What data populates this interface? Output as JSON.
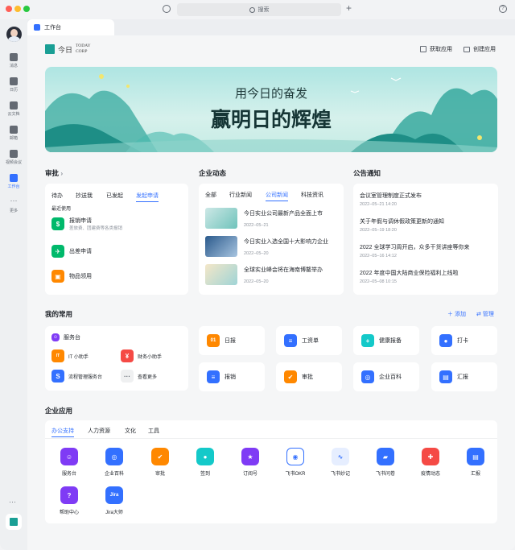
{
  "search": {
    "placeholder": "搜索"
  },
  "sidebar": {
    "items": [
      {
        "label": "消息",
        "icon": "chat-icon"
      },
      {
        "label": "日历",
        "icon": "calendar-icon"
      },
      {
        "label": "云文档",
        "icon": "docs-icon"
      },
      {
        "label": "邮箱",
        "icon": "mail-icon"
      },
      {
        "label": "视频会议",
        "icon": "video-icon"
      },
      {
        "label": "工作台",
        "icon": "workbench-icon",
        "active": true
      },
      {
        "label": "更多",
        "icon": "more-icon"
      }
    ]
  },
  "tab": {
    "label": "工作台"
  },
  "header": {
    "logo_line1": "TODAY",
    "logo_line2": "CORP",
    "logo_char": "今日",
    "get_apps": "获取应用",
    "create_app": "创建应用"
  },
  "banner": {
    "line1": "用今日的奋发",
    "line2": "赢明日的辉煌"
  },
  "approval": {
    "title": "审批",
    "tabs": [
      "待办",
      "抄送我",
      "已发起",
      "发起申请"
    ],
    "recent_label": "最近使用",
    "items": [
      {
        "name": "报销申请",
        "sub": "差旅费、团建费等各类报销",
        "color": "#00b96b"
      },
      {
        "name": "出差申请",
        "sub": "",
        "color": "#00b96b"
      },
      {
        "name": "物品领用",
        "sub": "",
        "color": "#ff8800"
      }
    ]
  },
  "news": {
    "title": "企业动态",
    "tabs": [
      "全部",
      "行业新闻",
      "公司新闻",
      "科技资讯"
    ],
    "items": [
      {
        "title": "今日实业公司最新产品全面上市",
        "date": "2022–05–21"
      },
      {
        "title": "今日实业入选全国十大影响力企业",
        "date": "2022–05–20"
      },
      {
        "title": "全球实业峰会将在海南博鳌举办",
        "date": "2022–05–20"
      }
    ]
  },
  "notice": {
    "title": "公告通知",
    "items": [
      {
        "title": "会议室管理制度正式发布",
        "date": "2022–05–21 14:20"
      },
      {
        "title": "关于年假与调休假政策更新的通知",
        "date": "2022–05–19 18:20"
      },
      {
        "title": "2022 全球学习周开启，众多干货讲座等你来",
        "date": "2022–05–16  14:12"
      },
      {
        "title": "2022 年度中国大陆商业保险福利上线啦",
        "date": "2022–05–08 10:15"
      }
    ]
  },
  "favorites": {
    "title": "我的常用",
    "add": "添加",
    "manage": "管理",
    "service": {
      "title": "服务台",
      "items": [
        "IT 小助手",
        "财务小助手",
        "流程管理服务台",
        "查看更多"
      ]
    },
    "tiles": [
      {
        "label": "日报",
        "color": "#ff8800",
        "glyph": "01"
      },
      {
        "label": "工资单",
        "color": "#3370ff",
        "glyph": "≡"
      },
      {
        "label": "健康报备",
        "color": "#14c9c9",
        "glyph": "+"
      },
      {
        "label": "打卡",
        "color": "#3370ff",
        "glyph": "●"
      },
      {
        "label": "报销",
        "color": "#3370ff",
        "glyph": "≡"
      },
      {
        "label": "审批",
        "color": "#ff8800",
        "glyph": "✔"
      },
      {
        "label": "企业百科",
        "color": "#3370ff",
        "glyph": "◎"
      },
      {
        "label": "汇报",
        "color": "#3370ff",
        "glyph": "▤"
      }
    ]
  },
  "enterprise_apps": {
    "title": "企业应用",
    "tabs": [
      "办公支持",
      "人力资源",
      "文化",
      "工具"
    ],
    "apps": [
      {
        "label": "服务台",
        "color": "#7f3bf5",
        "glyph": "☺"
      },
      {
        "label": "企业百科",
        "color": "#3370ff",
        "glyph": "◎"
      },
      {
        "label": "审批",
        "color": "#ff8800",
        "glyph": "✔"
      },
      {
        "label": "签到",
        "color": "#14c9c9",
        "glyph": "●"
      },
      {
        "label": "订阅号",
        "color": "#7f3bf5",
        "glyph": "★"
      },
      {
        "label": "飞书OKR",
        "color": "#3370ff",
        "glyph": "◉"
      },
      {
        "label": "飞书妙记",
        "color": "#3370ff",
        "glyph": "∿"
      },
      {
        "label": "飞书问卷",
        "color": "#3370ff",
        "glyph": "▰"
      },
      {
        "label": "疫情动态",
        "color": "#f54a45",
        "glyph": "✚"
      },
      {
        "label": "汇报",
        "color": "#3370ff",
        "glyph": "▤"
      },
      {
        "label": "帮助中心",
        "color": "#7f3bf5",
        "glyph": "?"
      },
      {
        "label": "Jira大师",
        "color": "#3370ff",
        "glyph": "Jira"
      }
    ]
  }
}
